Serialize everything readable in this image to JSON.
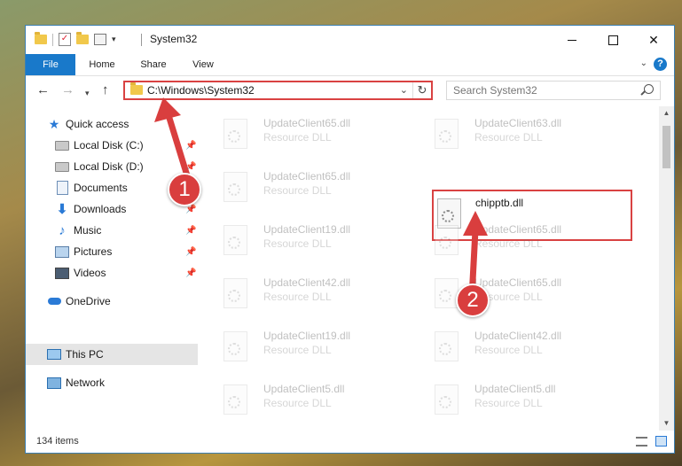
{
  "window": {
    "title": "System32"
  },
  "ribbon": {
    "tabs": [
      {
        "label": "File"
      },
      {
        "label": "Home"
      },
      {
        "label": "Share"
      },
      {
        "label": "View"
      }
    ]
  },
  "address": {
    "path": "C:\\Windows\\System32"
  },
  "search": {
    "placeholder": "Search System32"
  },
  "sidebar": {
    "items": [
      {
        "label": "Quick access",
        "icon": "star-icon"
      },
      {
        "label": "Local Disk (C:)",
        "icon": "drive-icon",
        "pinned": true
      },
      {
        "label": "Local Disk (D:)",
        "icon": "drive-icon",
        "pinned": true
      },
      {
        "label": "Documents",
        "icon": "documents-icon",
        "pinned": true
      },
      {
        "label": "Downloads",
        "icon": "downloads-icon",
        "pinned": true
      },
      {
        "label": "Music",
        "icon": "music-icon",
        "pinned": true
      },
      {
        "label": "Pictures",
        "icon": "pictures-icon",
        "pinned": true
      },
      {
        "label": "Videos",
        "icon": "videos-icon",
        "pinned": true
      },
      {
        "label": "OneDrive",
        "icon": "cloud-icon"
      },
      {
        "label": "This PC",
        "icon": "computer-icon",
        "selected": true
      },
      {
        "label": "Network",
        "icon": "network-icon"
      }
    ]
  },
  "files": [
    {
      "name": "UpdateClient65.dll",
      "type": "Resource DLL"
    },
    {
      "name": "UpdateClient63.dll",
      "type": "Resource DLL"
    },
    {
      "name": "UpdateClient65.dll",
      "type": "Resource DLL"
    },
    {
      "name": "chipptb.dll",
      "type": "",
      "highlighted": true
    },
    {
      "name": "UpdateClient19.dll",
      "type": "Resource DLL"
    },
    {
      "name": "UpdateClient65.dll",
      "type": "Resource DLL"
    },
    {
      "name": "UpdateClient42.dll",
      "type": "Resource DLL"
    },
    {
      "name": "UpdateClient65.dll",
      "type": "Resource DLL"
    },
    {
      "name": "UpdateClient19.dll",
      "type": "Resource DLL"
    },
    {
      "name": "UpdateClient42.dll",
      "type": "Resource DLL"
    },
    {
      "name": "UpdateClient5.dll",
      "type": "Resource DLL"
    },
    {
      "name": "UpdateClient5.dll",
      "type": "Resource DLL"
    }
  ],
  "status": {
    "item_count": "134 items"
  },
  "annotations": {
    "step1": "1",
    "step2": "2",
    "color": "#d93e3e"
  },
  "help": {
    "label": "?"
  }
}
